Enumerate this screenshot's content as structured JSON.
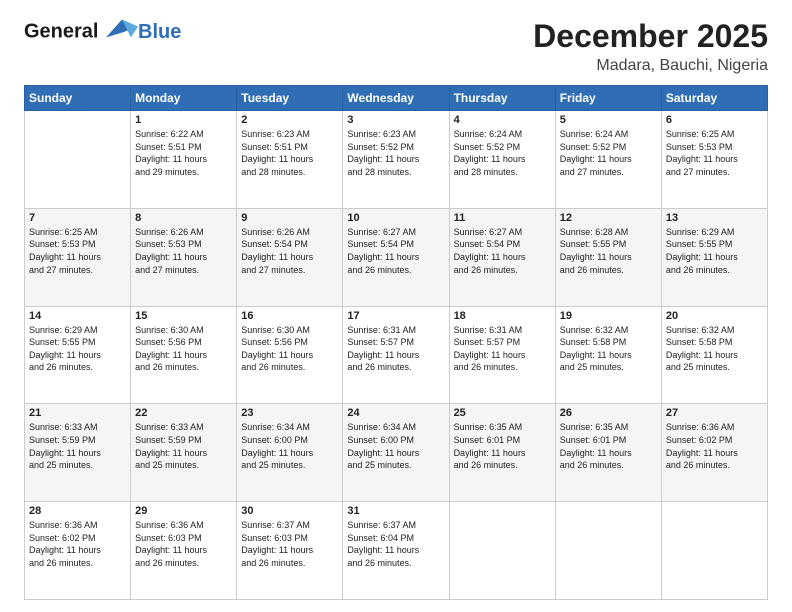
{
  "header": {
    "logo_line1": "General",
    "logo_line2": "Blue",
    "title": "December 2025",
    "subtitle": "Madara, Bauchi, Nigeria"
  },
  "days_of_week": [
    "Sunday",
    "Monday",
    "Tuesday",
    "Wednesday",
    "Thursday",
    "Friday",
    "Saturday"
  ],
  "weeks": [
    [
      {
        "day": "",
        "info": ""
      },
      {
        "day": "1",
        "info": "Sunrise: 6:22 AM\nSunset: 5:51 PM\nDaylight: 11 hours\nand 29 minutes."
      },
      {
        "day": "2",
        "info": "Sunrise: 6:23 AM\nSunset: 5:51 PM\nDaylight: 11 hours\nand 28 minutes."
      },
      {
        "day": "3",
        "info": "Sunrise: 6:23 AM\nSunset: 5:52 PM\nDaylight: 11 hours\nand 28 minutes."
      },
      {
        "day": "4",
        "info": "Sunrise: 6:24 AM\nSunset: 5:52 PM\nDaylight: 11 hours\nand 28 minutes."
      },
      {
        "day": "5",
        "info": "Sunrise: 6:24 AM\nSunset: 5:52 PM\nDaylight: 11 hours\nand 27 minutes."
      },
      {
        "day": "6",
        "info": "Sunrise: 6:25 AM\nSunset: 5:53 PM\nDaylight: 11 hours\nand 27 minutes."
      }
    ],
    [
      {
        "day": "7",
        "info": "Sunrise: 6:25 AM\nSunset: 5:53 PM\nDaylight: 11 hours\nand 27 minutes."
      },
      {
        "day": "8",
        "info": "Sunrise: 6:26 AM\nSunset: 5:53 PM\nDaylight: 11 hours\nand 27 minutes."
      },
      {
        "day": "9",
        "info": "Sunrise: 6:26 AM\nSunset: 5:54 PM\nDaylight: 11 hours\nand 27 minutes."
      },
      {
        "day": "10",
        "info": "Sunrise: 6:27 AM\nSunset: 5:54 PM\nDaylight: 11 hours\nand 26 minutes."
      },
      {
        "day": "11",
        "info": "Sunrise: 6:27 AM\nSunset: 5:54 PM\nDaylight: 11 hours\nand 26 minutes."
      },
      {
        "day": "12",
        "info": "Sunrise: 6:28 AM\nSunset: 5:55 PM\nDaylight: 11 hours\nand 26 minutes."
      },
      {
        "day": "13",
        "info": "Sunrise: 6:29 AM\nSunset: 5:55 PM\nDaylight: 11 hours\nand 26 minutes."
      }
    ],
    [
      {
        "day": "14",
        "info": "Sunrise: 6:29 AM\nSunset: 5:55 PM\nDaylight: 11 hours\nand 26 minutes."
      },
      {
        "day": "15",
        "info": "Sunrise: 6:30 AM\nSunset: 5:56 PM\nDaylight: 11 hours\nand 26 minutes."
      },
      {
        "day": "16",
        "info": "Sunrise: 6:30 AM\nSunset: 5:56 PM\nDaylight: 11 hours\nand 26 minutes."
      },
      {
        "day": "17",
        "info": "Sunrise: 6:31 AM\nSunset: 5:57 PM\nDaylight: 11 hours\nand 26 minutes."
      },
      {
        "day": "18",
        "info": "Sunrise: 6:31 AM\nSunset: 5:57 PM\nDaylight: 11 hours\nand 26 minutes."
      },
      {
        "day": "19",
        "info": "Sunrise: 6:32 AM\nSunset: 5:58 PM\nDaylight: 11 hours\nand 25 minutes."
      },
      {
        "day": "20",
        "info": "Sunrise: 6:32 AM\nSunset: 5:58 PM\nDaylight: 11 hours\nand 25 minutes."
      }
    ],
    [
      {
        "day": "21",
        "info": "Sunrise: 6:33 AM\nSunset: 5:59 PM\nDaylight: 11 hours\nand 25 minutes."
      },
      {
        "day": "22",
        "info": "Sunrise: 6:33 AM\nSunset: 5:59 PM\nDaylight: 11 hours\nand 25 minutes."
      },
      {
        "day": "23",
        "info": "Sunrise: 6:34 AM\nSunset: 6:00 PM\nDaylight: 11 hours\nand 25 minutes."
      },
      {
        "day": "24",
        "info": "Sunrise: 6:34 AM\nSunset: 6:00 PM\nDaylight: 11 hours\nand 25 minutes."
      },
      {
        "day": "25",
        "info": "Sunrise: 6:35 AM\nSunset: 6:01 PM\nDaylight: 11 hours\nand 26 minutes."
      },
      {
        "day": "26",
        "info": "Sunrise: 6:35 AM\nSunset: 6:01 PM\nDaylight: 11 hours\nand 26 minutes."
      },
      {
        "day": "27",
        "info": "Sunrise: 6:36 AM\nSunset: 6:02 PM\nDaylight: 11 hours\nand 26 minutes."
      }
    ],
    [
      {
        "day": "28",
        "info": "Sunrise: 6:36 AM\nSunset: 6:02 PM\nDaylight: 11 hours\nand 26 minutes."
      },
      {
        "day": "29",
        "info": "Sunrise: 6:36 AM\nSunset: 6:03 PM\nDaylight: 11 hours\nand 26 minutes."
      },
      {
        "day": "30",
        "info": "Sunrise: 6:37 AM\nSunset: 6:03 PM\nDaylight: 11 hours\nand 26 minutes."
      },
      {
        "day": "31",
        "info": "Sunrise: 6:37 AM\nSunset: 6:04 PM\nDaylight: 11 hours\nand 26 minutes."
      },
      {
        "day": "",
        "info": ""
      },
      {
        "day": "",
        "info": ""
      },
      {
        "day": "",
        "info": ""
      }
    ]
  ]
}
